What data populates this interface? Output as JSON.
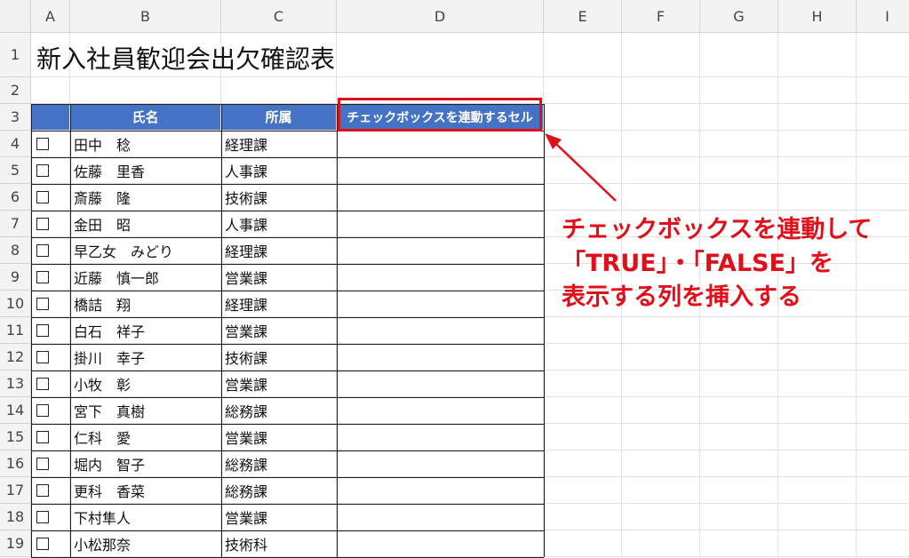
{
  "columns": [
    "A",
    "B",
    "C",
    "D",
    "E",
    "F",
    "G",
    "H",
    "I"
  ],
  "rows": [
    "1",
    "2",
    "3",
    "4",
    "5",
    "6",
    "7",
    "8",
    "9",
    "10",
    "11",
    "12",
    "13",
    "14",
    "15",
    "16",
    "17",
    "18",
    "19"
  ],
  "title": "新入社員歓迎会出欠確認表",
  "table": {
    "headers": {
      "name": "氏名",
      "dept": "所属",
      "linked": "チェックボックスを連動するセル"
    },
    "rows": [
      {
        "name": "田中　稔",
        "dept": "経理課",
        "checked": false
      },
      {
        "name": "佐藤　里香",
        "dept": "人事課",
        "checked": false
      },
      {
        "name": "斎藤　隆",
        "dept": "技術課",
        "checked": false
      },
      {
        "name": "金田　昭",
        "dept": "人事課",
        "checked": false
      },
      {
        "name": "早乙女　みどり",
        "dept": "経理課",
        "checked": false
      },
      {
        "name": "近藤　慎一郎",
        "dept": "営業課",
        "checked": false
      },
      {
        "name": "橋詰　翔",
        "dept": "経理課",
        "checked": false
      },
      {
        "name": "白石　祥子",
        "dept": "営業課",
        "checked": false
      },
      {
        "name": "掛川　幸子",
        "dept": "技術課",
        "checked": false
      },
      {
        "name": "小牧　彰",
        "dept": "営業課",
        "checked": false
      },
      {
        "name": "宮下　真樹",
        "dept": "総務課",
        "checked": false
      },
      {
        "name": "仁科　愛",
        "dept": "営業課",
        "checked": false
      },
      {
        "name": "堀内　智子",
        "dept": "総務課",
        "checked": false
      },
      {
        "name": "更科　香菜",
        "dept": "総務課",
        "checked": false
      },
      {
        "name": "下村隼人",
        "dept": "営業課",
        "checked": false
      },
      {
        "name": "小松那奈",
        "dept": "技術科",
        "checked": false
      }
    ]
  },
  "annotation": {
    "lines": [
      "チェックボックスを連動して",
      "「TRUE」・「FALSE」を",
      "表示する列を挿入する"
    ]
  },
  "colors": {
    "header_fill": "#4472c4",
    "highlight": "#e0101a"
  }
}
